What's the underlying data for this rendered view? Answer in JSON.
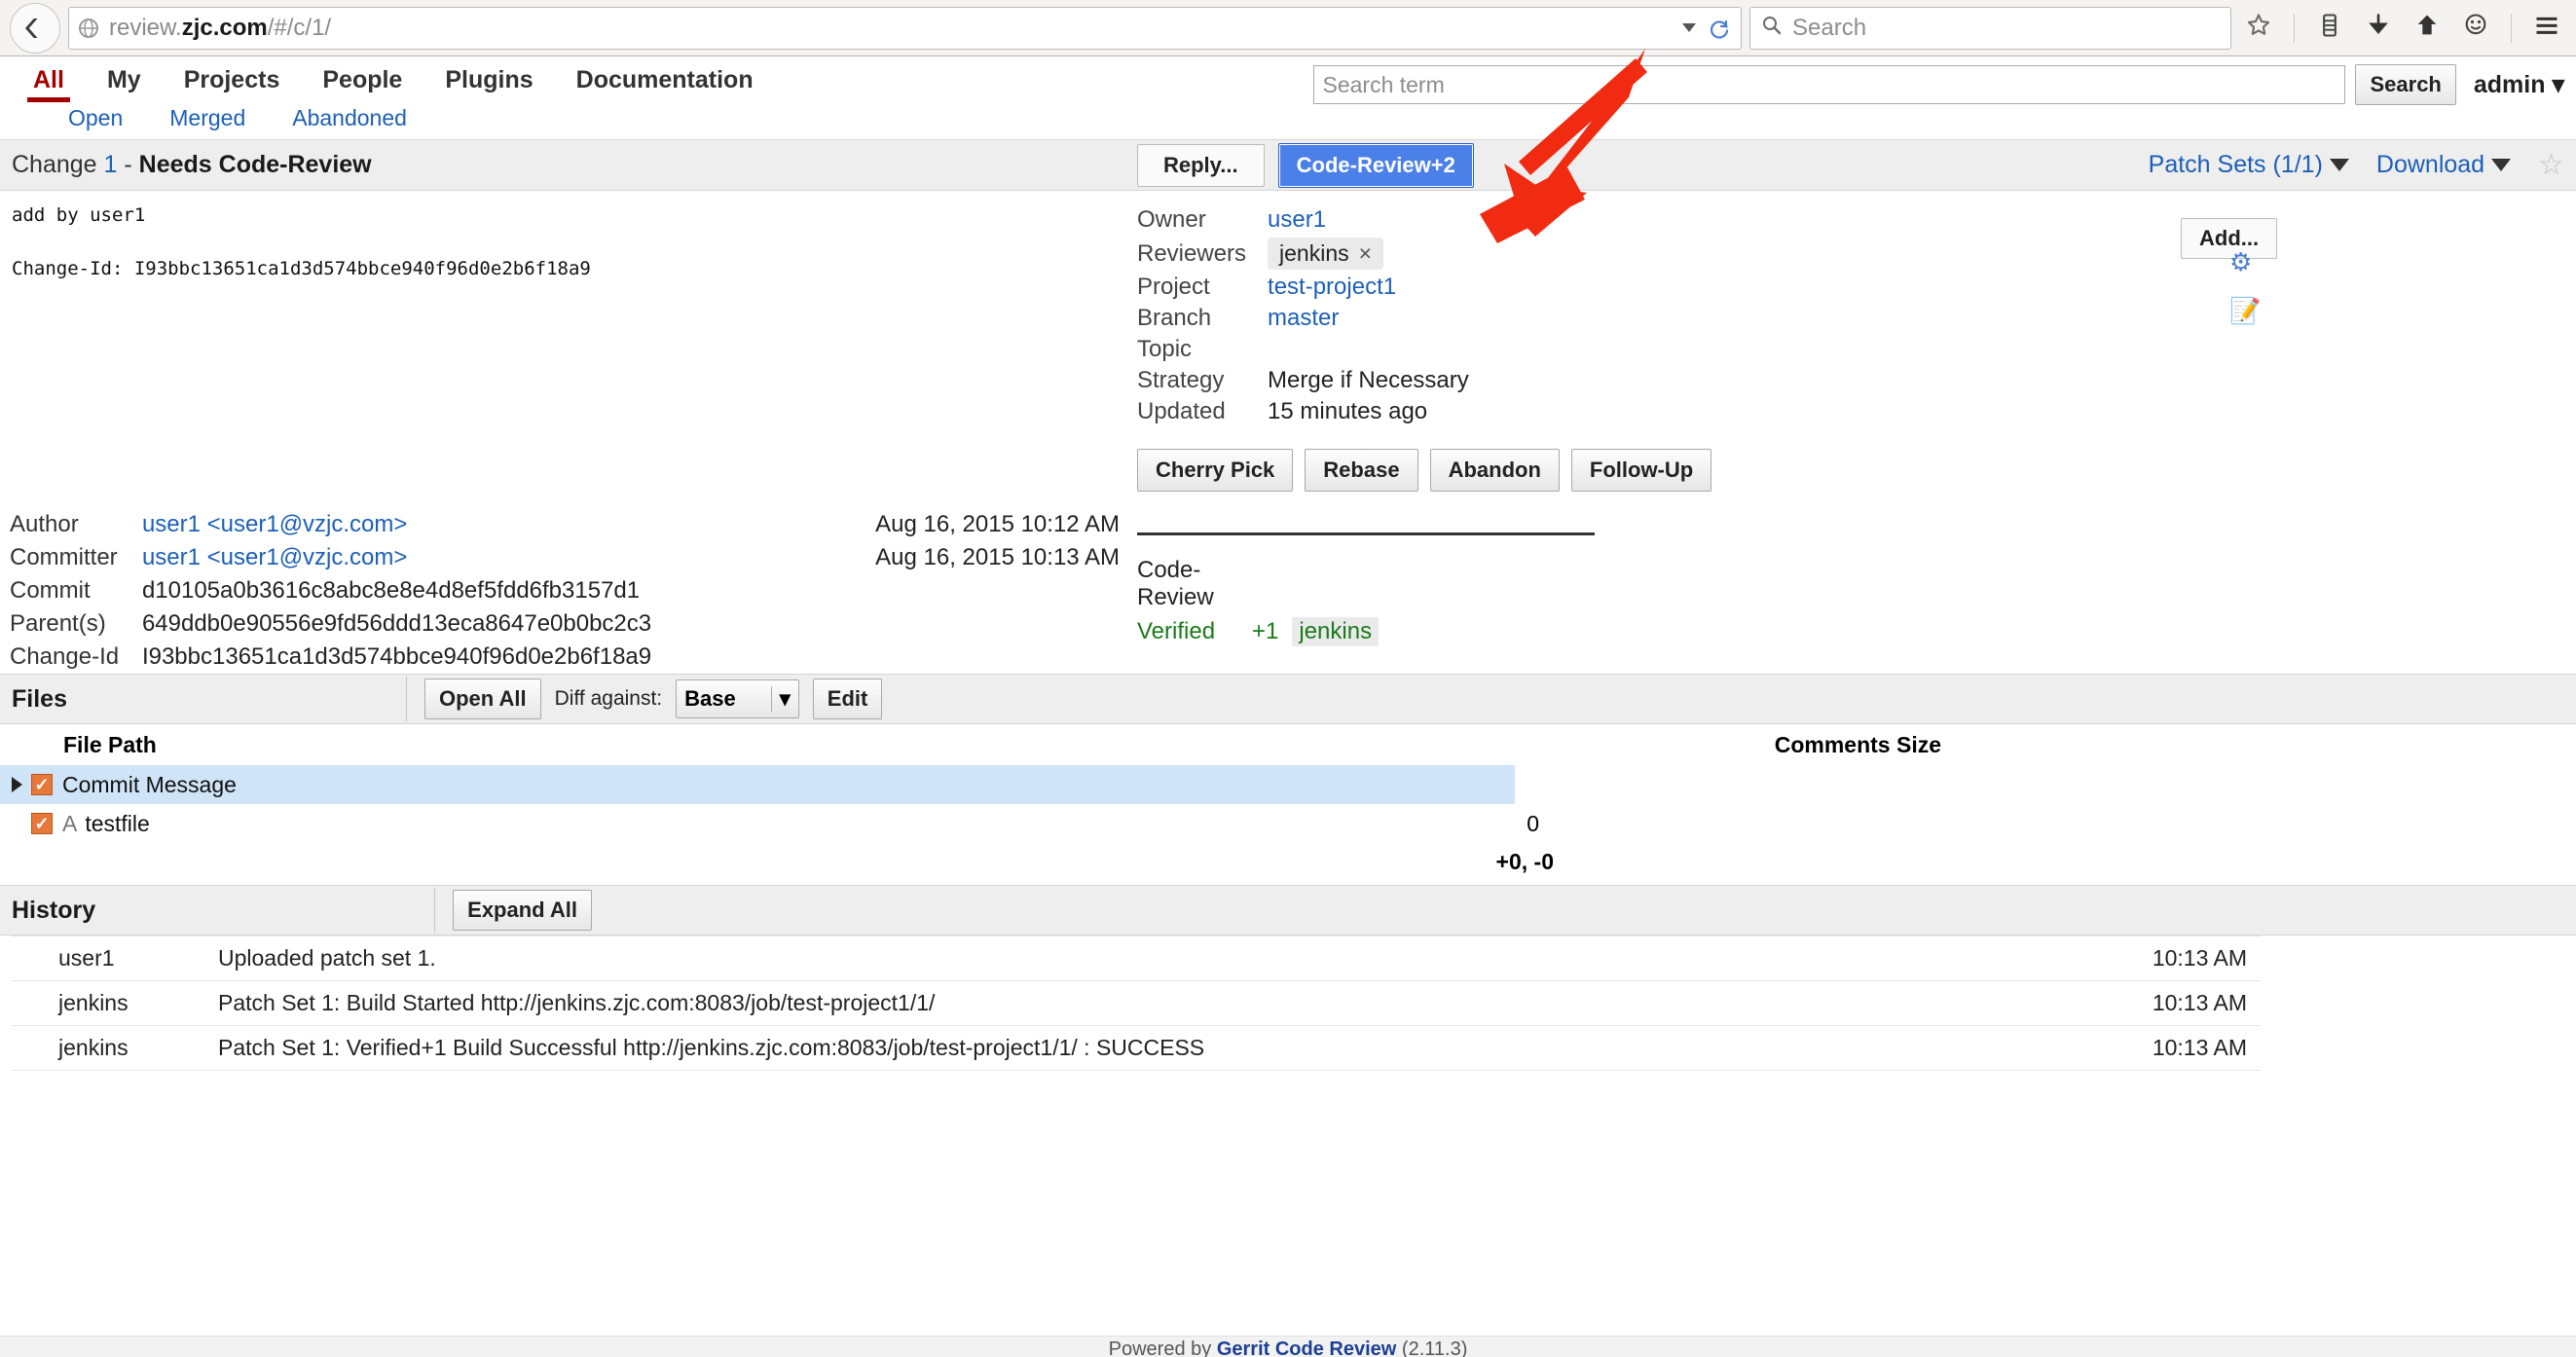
{
  "browser": {
    "url_prefix": "review.",
    "url_bold": "zjc.com",
    "url_suffix": "/#/c/1/",
    "search_placeholder": "Search",
    "icons": [
      "back-icon",
      "globe-icon",
      "dropdown-caret-icon",
      "reload-icon",
      "search-icon",
      "bookmark-star-icon",
      "library-icon",
      "downloads-icon",
      "home-icon",
      "sync-avatar-icon",
      "hamburger-menu-icon"
    ]
  },
  "gerrit": {
    "menu": [
      {
        "label": "All",
        "active": true
      },
      {
        "label": "My",
        "active": false
      },
      {
        "label": "Projects",
        "active": false
      },
      {
        "label": "People",
        "active": false
      },
      {
        "label": "Plugins",
        "active": false
      },
      {
        "label": "Documentation",
        "active": false
      }
    ],
    "subtabs": [
      "Open",
      "Merged",
      "Abandoned"
    ],
    "search_placeholder": "Search term",
    "search_button": "Search",
    "account": "admin"
  },
  "change": {
    "prefix": "Change",
    "number": "1",
    "separator": " - ",
    "status": "Needs Code-Review",
    "reply_button": "Reply...",
    "code_review_button": "Code-Review+2",
    "patch_sets": "Patch Sets (1/1)",
    "download": "Download",
    "commit_message": "add by user1\n\nChange-Id: I93bbc13651ca1d3d574bbce940f96d0e2b6f18a9"
  },
  "info": {
    "rows": [
      {
        "label": "Owner",
        "value": "user1",
        "link": true
      },
      {
        "label": "Project",
        "value": "test-project1",
        "link": true
      },
      {
        "label": "Branch",
        "value": "master",
        "link": true
      },
      {
        "label": "Topic",
        "value": "",
        "link": false
      },
      {
        "label": "Strategy",
        "value": "Merge if Necessary",
        "link": false
      },
      {
        "label": "Updated",
        "value": "15 minutes ago",
        "link": false
      }
    ],
    "reviewers_label": "Reviewers",
    "reviewer_chip": "jenkins",
    "reviewer_remove": "×",
    "add_button": "Add...",
    "actions": [
      "Cherry Pick",
      "Rebase",
      "Abandon",
      "Follow-Up"
    ]
  },
  "labels": {
    "code_review": {
      "name": "Code-Review",
      "value": "",
      "who": ""
    },
    "verified": {
      "name": "Verified",
      "value": "+1",
      "who": "jenkins"
    }
  },
  "commit_details": {
    "rows": [
      {
        "key": "Author",
        "value": "user1 <user1@vzjc.com>",
        "link": true,
        "date": "Aug 16, 2015 10:12 AM"
      },
      {
        "key": "Committer",
        "value": "user1 <user1@vzjc.com>",
        "link": true,
        "date": "Aug 16, 2015 10:13 AM"
      },
      {
        "key": "Commit",
        "value": "d10105a0b3616c8abc8e8e4d8ef5fdd6fb3157d1",
        "link": false,
        "date": ""
      },
      {
        "key": "Parent(s)",
        "value": "649ddb0e90556e9fd56ddd13eca8647e0b0bc2c3",
        "link": false,
        "date": ""
      },
      {
        "key": "Change-Id",
        "value": "I93bbc13651ca1d3d574bbce940f96d0e2b6f18a9",
        "link": false,
        "date": ""
      }
    ]
  },
  "files": {
    "title": "Files",
    "open_all": "Open All",
    "diff_against_label": "Diff against:",
    "diff_against_value": "Base",
    "edit": "Edit",
    "col_path": "File Path",
    "col_comments_size": "Comments Size",
    "rows": [
      {
        "expandable": true,
        "checked": true,
        "status": "",
        "name": "Commit Message",
        "size": "",
        "selected": true
      },
      {
        "expandable": false,
        "checked": true,
        "status": "A",
        "name": "testfile",
        "size": "0",
        "selected": false
      }
    ],
    "totals": "+0, -0"
  },
  "history": {
    "title": "History",
    "expand_all": "Expand All",
    "rows": [
      {
        "who": "user1",
        "message": "Uploaded patch set 1.",
        "time": "10:13 AM"
      },
      {
        "who": "jenkins",
        "message": "Patch Set 1: Build Started http://jenkins.zjc.com:8083/job/test-project1/1/",
        "time": "10:13 AM"
      },
      {
        "who": "jenkins",
        "message": "Patch Set 1: Verified+1 Build Successful http://jenkins.zjc.com:8083/job/test-project1/1/ : SUCCESS",
        "time": "10:13 AM"
      }
    ]
  },
  "footer": {
    "powered_by": "Powered by",
    "product": "Gerrit Code Review",
    "version": "(2.11.3)"
  },
  "colors": {
    "accent_blue": "#1c5fb8",
    "active_red": "#a40000",
    "button_blue": "#4a80e8",
    "verified_green": "#1a7a1a",
    "checkbox_orange": "#e8773a",
    "row_selected": "#cfe4f7",
    "annotation_arrow": "#f02b11"
  }
}
